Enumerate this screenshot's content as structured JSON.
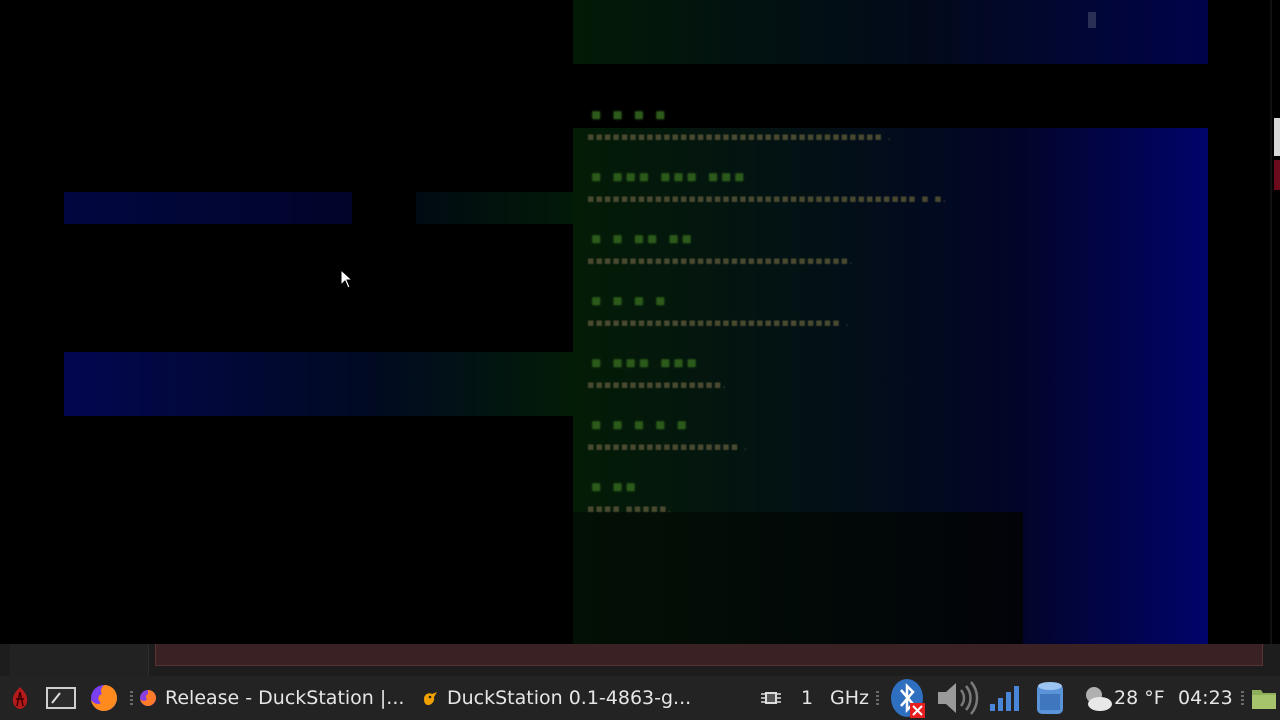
{
  "game": {
    "menu_items": [
      {
        "title": "▪ ▪ ▪ ▪",
        "desc": "▪▪▪▪▪▪▪▪▪▪▪▪▪▪▪▪▪▪▪▪▪▪▪▪▪▪▪▪▪▪▪▪▪▪▪ ."
      },
      {
        "title": "▪ ▪▪▪ ▪▪▪ ▪▪▪",
        "desc": "▪▪▪▪▪▪▪▪▪▪▪▪▪▪▪▪▪▪▪▪▪▪▪▪▪▪▪▪▪▪▪▪▪▪▪▪▪▪▪ ▪ ▪."
      },
      {
        "title": "▪ ▪ ▪▪ ▪▪",
        "desc": "▪▪▪▪▪▪▪▪▪▪▪▪▪▪▪▪▪▪▪▪▪▪▪▪▪▪▪▪▪▪▪."
      },
      {
        "title": "▪ ▪ ▪ ▪",
        "desc": "▪▪▪▪▪▪▪▪▪▪▪▪▪▪▪▪▪▪▪▪▪▪▪▪▪▪▪▪▪▪ ."
      },
      {
        "title": "▪ ▪▪▪ ▪▪▪",
        "desc": "▪▪▪▪▪▪▪▪▪▪▪▪▪▪▪▪."
      },
      {
        "title": "▪ ▪ ▪ ▪ ▪",
        "desc": "▪▪▪▪▪▪▪▪▪▪▪▪▪▪▪▪▪▪ ."
      },
      {
        "title": "▪ ▪▪",
        "desc": "▪▪▪▪ ▪▪▪▪▪."
      }
    ]
  },
  "taskbar": {
    "tasks": [
      {
        "label": "Release - DuckStation |...",
        "icon": "firefox-icon"
      },
      {
        "label": "DuckStation 0.1-4863-g...",
        "icon": "duckstation-icon"
      }
    ],
    "cpu_count": "1",
    "cpu_freq_unit": "GHz",
    "weather": "28 °F",
    "clock": "04:23"
  },
  "colors": {
    "taskbar_bg": "#232323",
    "menu_title": "#2c5a1a",
    "menu_desc": "#4a4a30",
    "panel_blue": "#01046a"
  }
}
